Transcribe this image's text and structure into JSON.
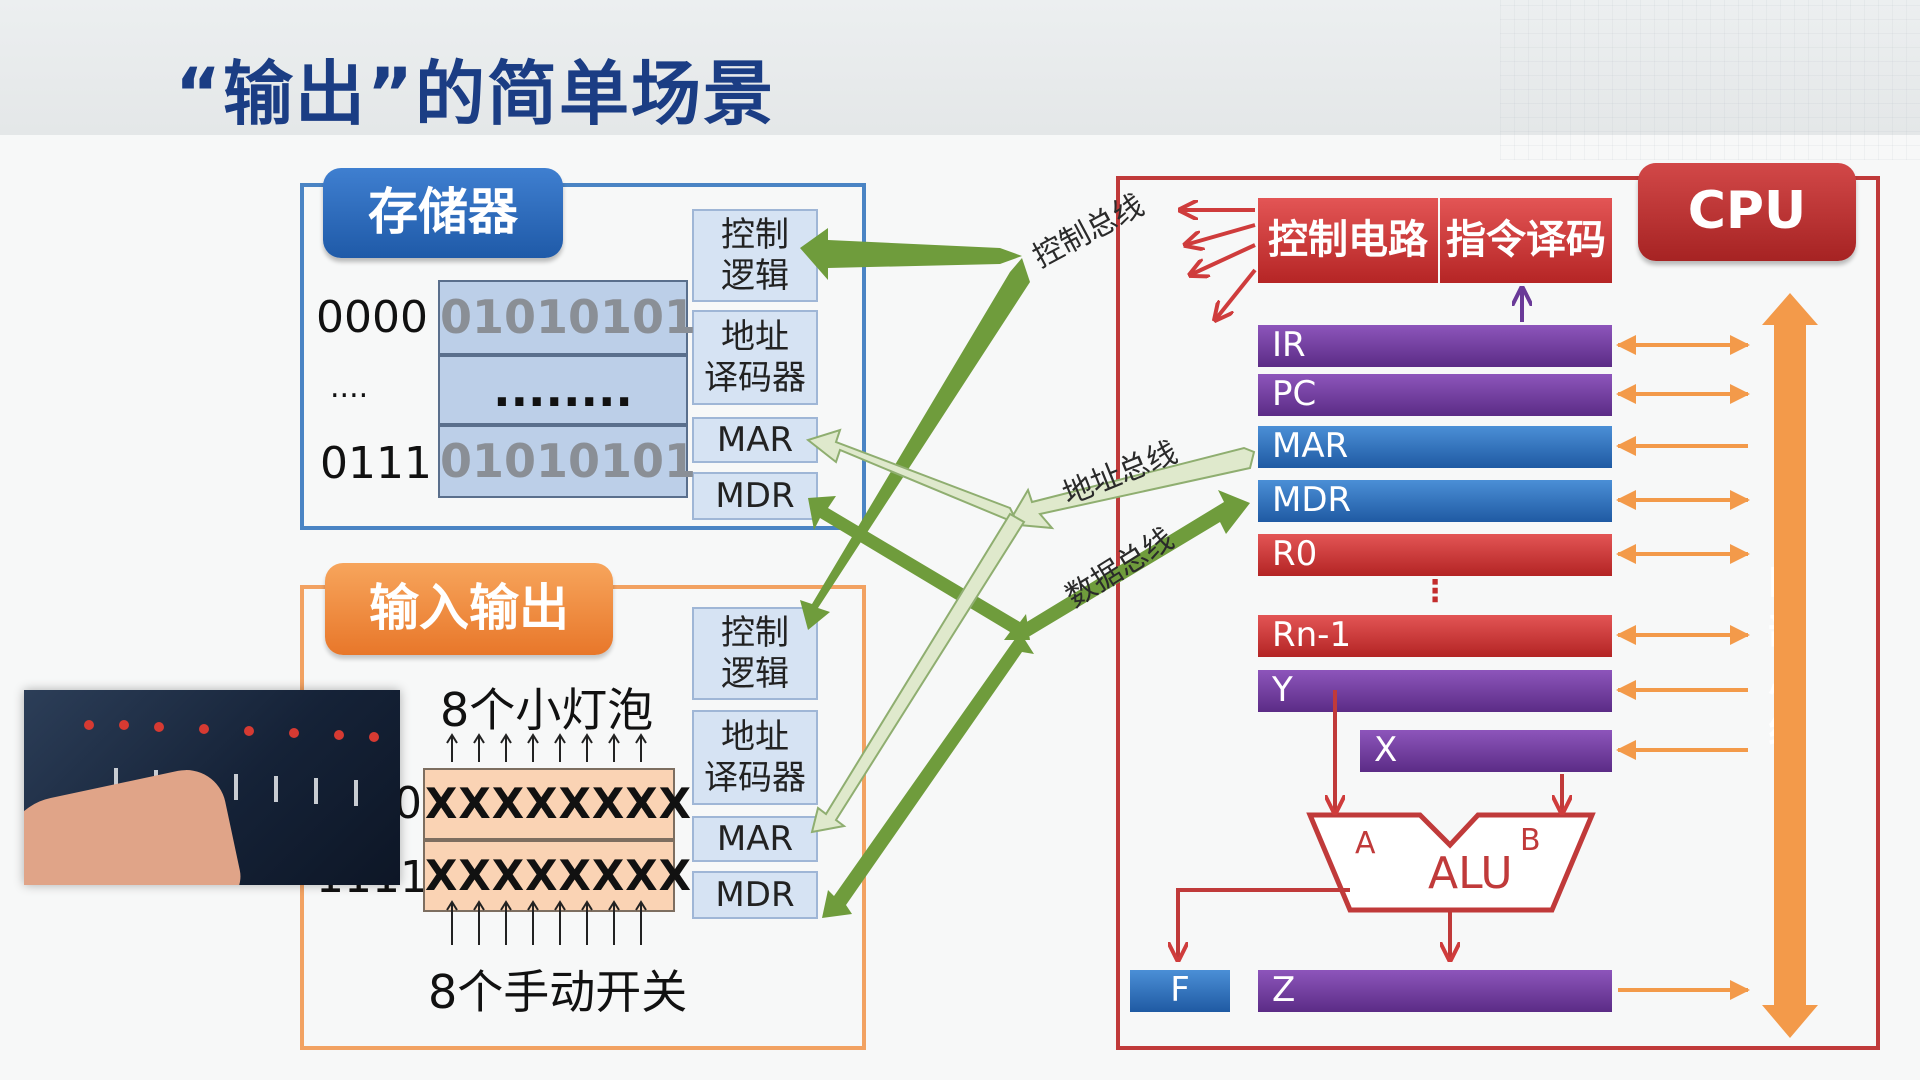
{
  "title": "“输出”的简单场景",
  "memory": {
    "tab_label": "存储器",
    "control_logic": "控制\n逻辑",
    "addr_decoder": "地址\n译码器",
    "mar": "MAR",
    "mdr": "MDR",
    "rows": [
      {
        "address": "0000",
        "value": "01010101"
      },
      {
        "address": "....",
        "value": "........"
      },
      {
        "address": "0111",
        "value": "01010101"
      }
    ]
  },
  "io": {
    "tab_label": "输入输出",
    "control_logic": "控制\n逻辑",
    "addr_decoder": "地址\n译码器",
    "mar": "MAR",
    "mdr": "MDR",
    "lamps_label": "8个小灯泡",
    "switches_label": "8个手动开关",
    "rows": [
      {
        "address": "1110",
        "value": "XXXXXXXX"
      },
      {
        "address": "1111",
        "value": "XXXXXXXX"
      }
    ]
  },
  "buses": {
    "control": "控制总线",
    "address": "地址总线",
    "data": "数据总线"
  },
  "cpu": {
    "tab_label": "CPU",
    "control_circuit": "控制电路",
    "instruction_decode": "指令译码",
    "registers": {
      "ir": "IR",
      "pc": "PC",
      "mar": "MAR",
      "mdr": "MDR",
      "r0": "R0",
      "ellipsis": "⋮",
      "rn1": "Rn-1",
      "y": "Y",
      "x": "X",
      "z": "Z",
      "f": "F"
    },
    "alu": {
      "label": "ALU",
      "a": "A",
      "b": "B"
    },
    "internal_bus": "内部总线"
  },
  "colors": {
    "title": "#1b3d84",
    "memory_frame": "#4a84c4",
    "io_frame": "#f2a262",
    "cpu_frame": "#c03a3a",
    "bus_green": "#6f9c3c",
    "bus_light_green": "#dfe9cc",
    "internal_bus_orange": "#f39a4a",
    "purple_reg": "#6a3a98",
    "blue_reg": "#2a6bb5",
    "red_reg": "#c83232"
  },
  "icons": [
    "front-panel-photo",
    "bidirectional-arrow",
    "up-arrow"
  ]
}
